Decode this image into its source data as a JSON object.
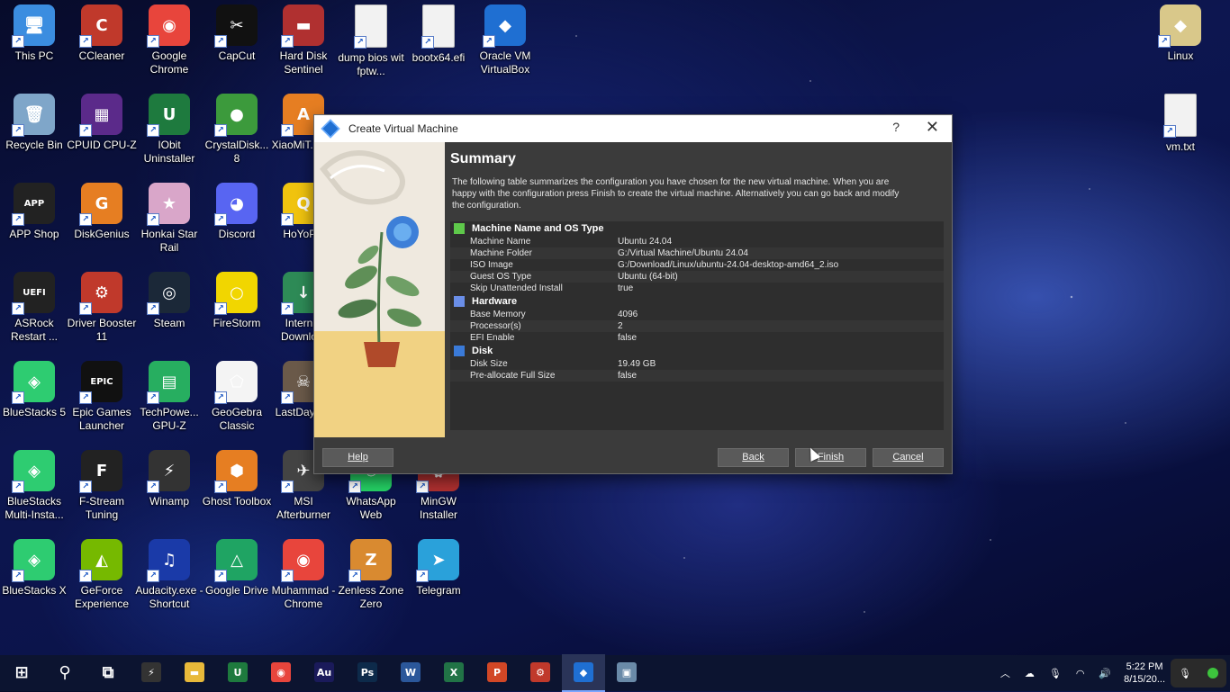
{
  "desktop": {
    "icons": [
      {
        "label": "This PC",
        "color": "#3b8de0",
        "glyph": "🖥",
        "name": "this-pc-icon"
      },
      {
        "label": "CCleaner",
        "color": "#c0392b",
        "glyph": "C",
        "name": "ccleaner-icon"
      },
      {
        "label": "Google Chrome",
        "color": "#e8453c",
        "glyph": "◉",
        "name": "chrome-icon"
      },
      {
        "label": "CapCut",
        "color": "#111111",
        "glyph": "✂",
        "name": "capcut-icon"
      },
      {
        "label": "Hard Disk Sentinel",
        "color": "#b03030",
        "glyph": "▬",
        "name": "hard-disk-sentinel-icon"
      },
      {
        "label": "dump bios wit fptw...",
        "color": "#f2f2f2",
        "glyph": "",
        "name": "file-icon"
      },
      {
        "label": "bootx64.efi",
        "color": "#f2f2f2",
        "glyph": "",
        "name": "file-icon"
      },
      {
        "label": "Oracle VM VirtualBox",
        "color": "#1f6fd2",
        "glyph": "◆",
        "name": "virtualbox-icon"
      },
      {
        "label": "Recycle Bin",
        "color": "#7fa6c9",
        "glyph": "🗑",
        "name": "recycle-bin-icon"
      },
      {
        "label": "CPUID CPU-Z",
        "color": "#5b2a8a",
        "glyph": "▦",
        "name": "cpu-z-icon"
      },
      {
        "label": "IObit Uninstaller",
        "color": "#1e7a3e",
        "glyph": "U",
        "name": "iobit-icon"
      },
      {
        "label": "CrystalDisk... 8",
        "color": "#3c9a3c",
        "glyph": "●",
        "name": "crystaldisk-icon"
      },
      {
        "label": "XiaoMiT... V2",
        "color": "#e67e22",
        "glyph": "A",
        "name": "xiaomi-tool-icon"
      },
      {
        "label": "APP Shop",
        "color": "#222222",
        "glyph": "APP",
        "name": "app-shop-icon"
      },
      {
        "label": "DiskGenius",
        "color": "#e67e22",
        "glyph": "G",
        "name": "diskgenius-icon"
      },
      {
        "label": "Honkai Star Rail",
        "color": "#d9a6c9",
        "glyph": "★",
        "name": "honkai-icon"
      },
      {
        "label": "Discord",
        "color": "#5865f2",
        "glyph": "◕",
        "name": "discord-icon"
      },
      {
        "label": "HoYoP...",
        "color": "#f1c40f",
        "glyph": "Q",
        "name": "hoyoplay-icon"
      },
      {
        "label": "ASRock Restart ...",
        "color": "#222222",
        "glyph": "UEFI",
        "name": "asrock-icon"
      },
      {
        "label": "Driver Booster 11",
        "color": "#c0392b",
        "glyph": "⚙",
        "name": "driver-booster-icon"
      },
      {
        "label": "Steam",
        "color": "#1b2838",
        "glyph": "◎",
        "name": "steam-icon"
      },
      {
        "label": "FireStorm",
        "color": "#f1d600",
        "glyph": "○",
        "name": "firestorm-icon"
      },
      {
        "label": "Intern... Downlo...",
        "color": "#2e8b57",
        "glyph": "↓",
        "name": "idm-icon"
      },
      {
        "label": "BlueStacks 5",
        "color": "#2ecc71",
        "glyph": "◈",
        "name": "bluestacks-icon"
      },
      {
        "label": "Epic Games Launcher",
        "color": "#111111",
        "glyph": "EPIC",
        "name": "epic-games-icon"
      },
      {
        "label": "TechPowe... GPU-Z",
        "color": "#27ae60",
        "glyph": "▤",
        "name": "gpu-z-icon"
      },
      {
        "label": "GeoGebra Classic",
        "color": "#f4f4f4",
        "glyph": "⬠",
        "name": "geogebra-icon"
      },
      {
        "label": "LastDayC...",
        "color": "#6b5a4a",
        "glyph": "☠",
        "name": "game-icon"
      },
      {
        "label": "BlueStacks Multi-Insta...",
        "color": "#2ecc71",
        "glyph": "◈",
        "name": "bluestacks-multi-icon"
      },
      {
        "label": "F-Stream Tuning",
        "color": "#222222",
        "glyph": "F",
        "name": "f-stream-icon"
      },
      {
        "label": "Winamp",
        "color": "#333333",
        "glyph": "⚡",
        "name": "winamp-icon"
      },
      {
        "label": "Ghost Toolbox",
        "color": "#e67e22",
        "glyph": "⬢",
        "name": "ghost-toolbox-icon"
      },
      {
        "label": "MSI Afterburner",
        "color": "#444444",
        "glyph": "✈",
        "name": "msi-afterburner-icon"
      },
      {
        "label": "WhatsApp Web",
        "color": "#25d366",
        "glyph": "✆",
        "name": "whatsapp-icon"
      },
      {
        "label": "MinGW Installer",
        "color": "#b03030",
        "glyph": "⛭",
        "name": "mingw-icon"
      },
      {
        "label": "BlueStacks X",
        "color": "#2ecc71",
        "glyph": "◈",
        "name": "bluestacks-x-icon"
      },
      {
        "label": "GeForce Experience",
        "color": "#76b900",
        "glyph": "◭",
        "name": "geforce-icon"
      },
      {
        "label": "Audacity.exe - Shortcut",
        "color": "#1a3aa8",
        "glyph": "♫",
        "name": "audacity-icon"
      },
      {
        "label": "Google Drive",
        "color": "#1fa463",
        "glyph": "△",
        "name": "google-drive-icon"
      },
      {
        "label": "Muhammad - Chrome",
        "color": "#e8453c",
        "glyph": "◉",
        "name": "chrome-profile-icon"
      },
      {
        "label": "Zenless Zone Zero",
        "color": "#d98a30",
        "glyph": "Z",
        "name": "zenless-icon"
      },
      {
        "label": "Telegram",
        "color": "#2aa1da",
        "glyph": "➤",
        "name": "telegram-icon"
      },
      {
        "label": "Linux",
        "color": "#d9c88a",
        "glyph": "◆",
        "name": "linux-file-icon"
      },
      {
        "label": "vm.txt",
        "color": "#f2f2f2",
        "glyph": "",
        "name": "text-file-icon"
      }
    ]
  },
  "dialog": {
    "title": "Create Virtual Machine",
    "help_glyph": "?",
    "close_glyph": "✕",
    "summary_title": "Summary",
    "description": "The following table summarizes the configuration you have chosen for the new virtual machine. When you are happy with the configuration press Finish to create the virtual machine. Alternatively you can go back and modify the configuration.",
    "sections": [
      {
        "title": "Machine Name and OS Type",
        "icon_color": "#5ec84a",
        "rows": [
          {
            "k": "Machine Name",
            "v": "Ubuntu 24.04"
          },
          {
            "k": "Machine Folder",
            "v": "G:/Virtual Machine/Ubuntu 24.04"
          },
          {
            "k": "ISO Image",
            "v": "G:/Download/Linux/ubuntu-24.04-desktop-amd64_2.iso"
          },
          {
            "k": "Guest OS Type",
            "v": "Ubuntu (64-bit)"
          },
          {
            "k": "Skip Unattended Install",
            "v": "true"
          }
        ]
      },
      {
        "title": "Hardware",
        "icon_color": "#6a8ee8",
        "rows": [
          {
            "k": "Base Memory",
            "v": "4096"
          },
          {
            "k": "Processor(s)",
            "v": "2"
          },
          {
            "k": "EFI Enable",
            "v": "false"
          }
        ]
      },
      {
        "title": "Disk",
        "icon_color": "#3a7ad8",
        "rows": [
          {
            "k": "Disk Size",
            "v": "19.49 GB"
          },
          {
            "k": "Pre-allocate Full Size",
            "v": "false"
          }
        ]
      }
    ],
    "buttons": {
      "help": "Help",
      "back": "Back",
      "finish": "Finish",
      "cancel": "Cancel"
    }
  },
  "taskbar": {
    "apps": [
      {
        "name": "start-icon",
        "glyph": "⊞",
        "color": "transparent"
      },
      {
        "name": "search-icon",
        "glyph": "⚲",
        "color": "transparent"
      },
      {
        "name": "task-view-icon",
        "glyph": "⧉",
        "color": "transparent"
      },
      {
        "name": "winamp-taskbar-icon",
        "glyph": "⚡",
        "color": "#333333"
      },
      {
        "name": "file-explorer-icon",
        "glyph": "▬",
        "color": "#e8b93a"
      },
      {
        "name": "iobit-taskbar-icon",
        "glyph": "U",
        "color": "#1e7a3e"
      },
      {
        "name": "chrome-taskbar-icon",
        "glyph": "◉",
        "color": "#e8453c"
      },
      {
        "name": "audition-icon",
        "glyph": "Au",
        "color": "#1a1a5a"
      },
      {
        "name": "photoshop-icon",
        "glyph": "Ps",
        "color": "#0d2a4a"
      },
      {
        "name": "word-icon",
        "glyph": "W",
        "color": "#2b579a"
      },
      {
        "name": "excel-icon",
        "glyph": "X",
        "color": "#217346"
      },
      {
        "name": "powerpoint-icon",
        "glyph": "P",
        "color": "#d24726"
      },
      {
        "name": "driver-booster-taskbar-icon",
        "glyph": "⚙",
        "color": "#c0392b"
      },
      {
        "name": "virtualbox-taskbar-icon",
        "glyph": "◆",
        "color": "#1f6fd2"
      },
      {
        "name": "remote-desktop-icon",
        "glyph": "▣",
        "color": "#6a8aa8"
      }
    ],
    "time": "5:22 PM",
    "date": "8/15/20..."
  }
}
